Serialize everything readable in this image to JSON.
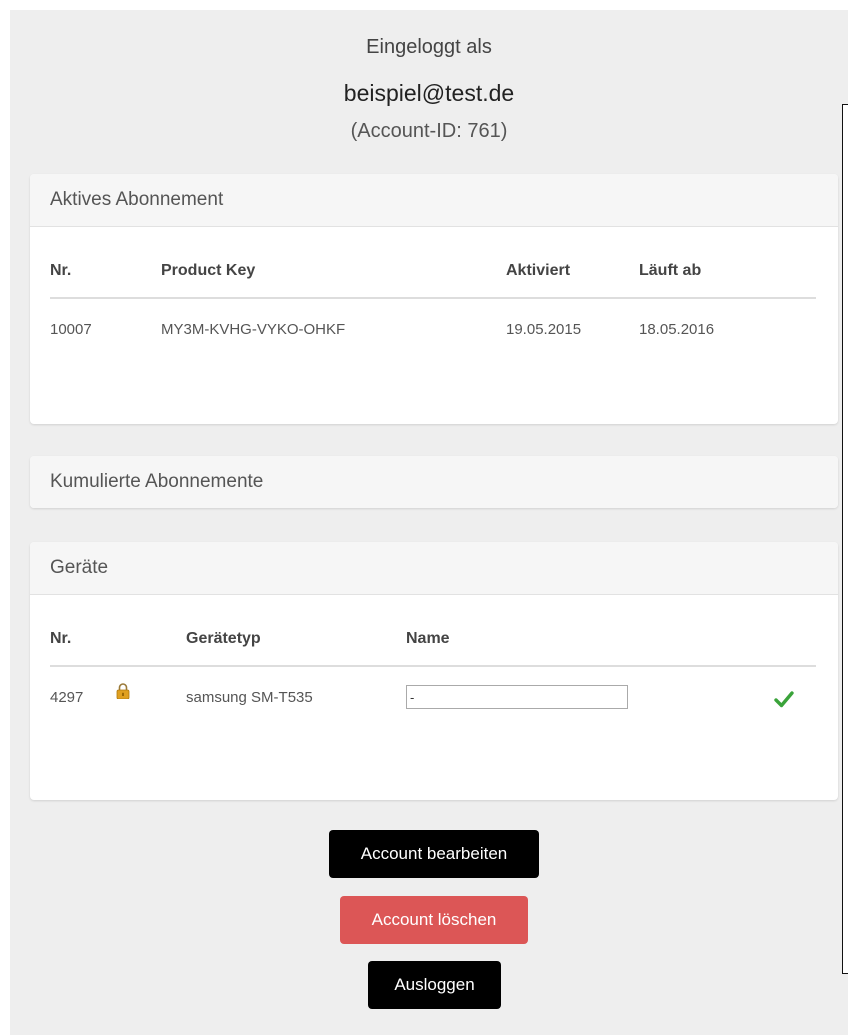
{
  "header": {
    "logged_in_label": "Eingeloggt als",
    "email": "beispiel@test.de",
    "account_id": "(Account-ID: 761)"
  },
  "active_subscription": {
    "title": "Aktives Abonnement",
    "columns": [
      "Nr.",
      "Product Key",
      "Aktiviert",
      "Läuft ab"
    ],
    "rows": [
      {
        "nr": "10007",
        "product_key": "MY3M-KVHG-VYKO-OHKF",
        "activated": "19.05.2015",
        "expires": "18.05.2016"
      }
    ]
  },
  "cumulative_subscriptions": {
    "title": "Kumulierte Abonnemente"
  },
  "devices": {
    "title": "Geräte",
    "columns": [
      "Nr.",
      "",
      "Gerätetyp",
      "Name"
    ],
    "rows": [
      {
        "nr": "4297",
        "lock_icon": "lock-icon",
        "device_type": "samsung SM-T535",
        "name_value": "-",
        "confirm_icon": "checkmark-icon"
      }
    ]
  },
  "buttons": {
    "edit": "Account bearbeiten",
    "delete": "Account löschen",
    "logout": "Ausloggen"
  },
  "colors": {
    "danger": "#dc5656",
    "dark_button": "#000000",
    "check": "#3aa33a",
    "lock": "#e0a020"
  }
}
